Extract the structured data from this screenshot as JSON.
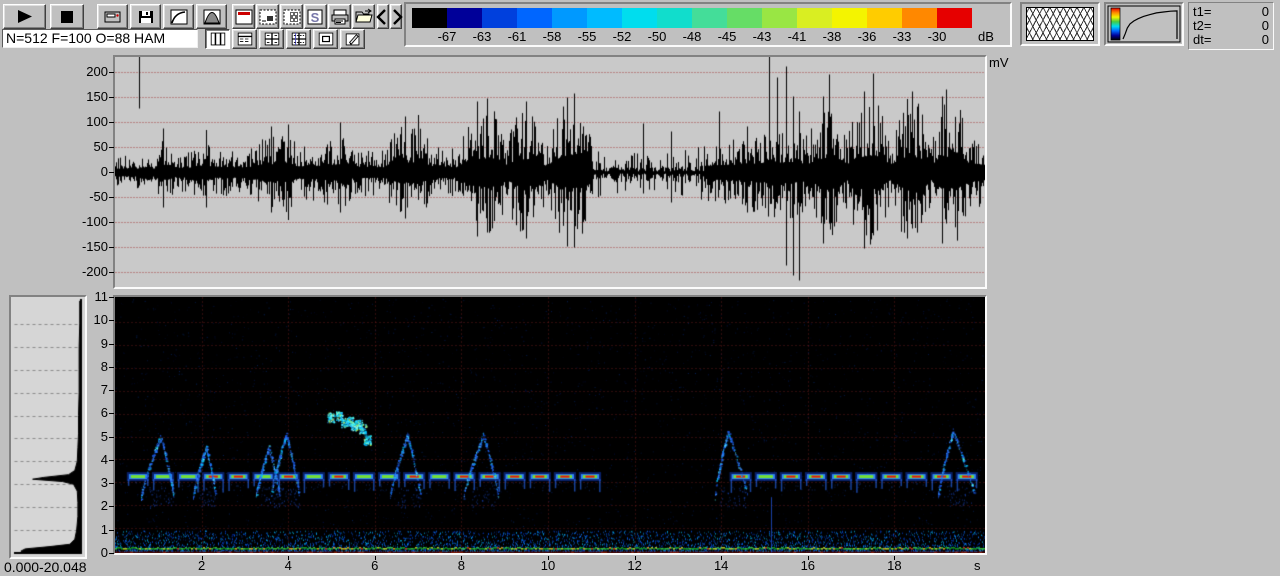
{
  "app": {
    "background": "#c0c0c0"
  },
  "toolbar": {
    "status_text": "N=512 F=100 O=88 HAM",
    "row1": [
      "play",
      "stop",
      "device",
      "save",
      "transfer",
      "window",
      "range",
      "fft",
      "pattern",
      "spectrum-s",
      "print",
      "open",
      "prev",
      "next"
    ],
    "row2": [
      "view-oscillogram",
      "view-sonagram",
      "view-split",
      "view-grid",
      "view-single",
      "edit"
    ]
  },
  "colorbar": {
    "unit": "dB",
    "ticks": [
      "-67",
      "-63",
      "-61",
      "-58",
      "-55",
      "-52",
      "-50",
      "-48",
      "-45",
      "-43",
      "-41",
      "-38",
      "-36",
      "-33",
      "-30"
    ],
    "colors": [
      "#000000",
      "#000099",
      "#0040dd",
      "#0066ff",
      "#0099ff",
      "#00bbff",
      "#00ddee",
      "#11ddcc",
      "#44dd99",
      "#66dd66",
      "#99e644",
      "#d9ee22",
      "#f4f400",
      "#ffcc00",
      "#ff8800",
      "#e60000"
    ]
  },
  "transfer_box": {
    "curve": [
      [
        0,
        0
      ],
      [
        0.04,
        0.18
      ],
      [
        0.08,
        0.38
      ],
      [
        0.13,
        0.52
      ],
      [
        0.2,
        0.62
      ],
      [
        0.28,
        0.7
      ],
      [
        0.38,
        0.78
      ],
      [
        0.5,
        0.84
      ],
      [
        0.62,
        0.9
      ],
      [
        0.75,
        0.93
      ],
      [
        0.88,
        0.96
      ],
      [
        1,
        0.97
      ]
    ],
    "bar_colors": [
      "#e60000",
      "#ff8800",
      "#f4f400",
      "#44cc44",
      "#00ddee",
      "#0066ff",
      "#000099",
      "#000000"
    ]
  },
  "time_readout": {
    "rows": [
      {
        "label": "t1=",
        "value": "0"
      },
      {
        "label": "t2=",
        "value": "0"
      },
      {
        "label": "dt=",
        "value": "0"
      }
    ]
  },
  "chart_data": [
    {
      "type": "line",
      "title": "oscillogram",
      "ylabel": "mV",
      "xlim_s": [
        0,
        20.048
      ],
      "ylim_mV": [
        -232,
        232
      ],
      "yticks_mV": [
        200,
        150,
        100,
        50,
        0,
        -50,
        -100,
        -150,
        -200
      ],
      "grid": "dotted-red-horizontal",
      "envelope_mV": [
        [
          0,
          34
        ],
        [
          0.9,
          36
        ],
        [
          1.0,
          60
        ],
        [
          1.2,
          68
        ],
        [
          1.35,
          42
        ],
        [
          1.9,
          46
        ],
        [
          2.05,
          66
        ],
        [
          2.3,
          48
        ],
        [
          3.1,
          46
        ],
        [
          3.4,
          72
        ],
        [
          3.95,
          80
        ],
        [
          4.25,
          52
        ],
        [
          4.8,
          62
        ],
        [
          5.2,
          76
        ],
        [
          5.55,
          50
        ],
        [
          6.2,
          48
        ],
        [
          6.55,
          92
        ],
        [
          7.05,
          90
        ],
        [
          7.35,
          52
        ],
        [
          7.9,
          48
        ],
        [
          8.2,
          120
        ],
        [
          8.75,
          128
        ],
        [
          9.05,
          62
        ],
        [
          9.25,
          118
        ],
        [
          9.65,
          122
        ],
        [
          9.95,
          60
        ],
        [
          10.25,
          132
        ],
        [
          10.75,
          140
        ],
        [
          11.0,
          62
        ],
        [
          11.4,
          42
        ],
        [
          12.5,
          40
        ],
        [
          13.4,
          52
        ],
        [
          13.9,
          66
        ],
        [
          14.5,
          72
        ],
        [
          15.0,
          88
        ],
        [
          15.6,
          92
        ],
        [
          16.0,
          78
        ],
        [
          16.25,
          118
        ],
        [
          16.6,
          138
        ],
        [
          16.9,
          72
        ],
        [
          17.15,
          138
        ],
        [
          17.6,
          148
        ],
        [
          17.9,
          68
        ],
        [
          18.15,
          128
        ],
        [
          18.55,
          138
        ],
        [
          18.85,
          68
        ],
        [
          19.05,
          138
        ],
        [
          19.45,
          142
        ],
        [
          19.7,
          88
        ],
        [
          20.05,
          70
        ]
      ],
      "sparse_region_s": [
        11,
        13.6
      ],
      "spikes_mV": [
        [
          0.55,
          232,
          128
        ],
        [
          1.1,
          88,
          -70
        ],
        [
          2.1,
          85,
          -70
        ],
        [
          3.6,
          92,
          -80
        ],
        [
          4.0,
          96,
          -95
        ],
        [
          5.2,
          100,
          -80
        ],
        [
          6.7,
          112,
          -92
        ],
        [
          7.0,
          115,
          -50
        ],
        [
          8.35,
          142,
          -128
        ],
        [
          8.6,
          148,
          -120
        ],
        [
          9.5,
          142,
          -132
        ],
        [
          10.45,
          150,
          -148
        ],
        [
          10.6,
          158,
          -150
        ],
        [
          12.2,
          98,
          -42
        ],
        [
          12.85,
          82,
          -60
        ],
        [
          13.95,
          122,
          -35
        ],
        [
          14.6,
          92,
          -80
        ],
        [
          15.1,
          248,
          -32
        ],
        [
          15.3,
          190,
          -62
        ],
        [
          15.5,
          212,
          -186
        ],
        [
          15.65,
          152,
          -206
        ],
        [
          15.8,
          122,
          -216
        ],
        [
          16.35,
          152,
          -142
        ],
        [
          16.5,
          196,
          -102
        ],
        [
          17.3,
          162,
          -152
        ],
        [
          17.5,
          198,
          -122
        ],
        [
          18.3,
          147,
          -132
        ],
        [
          18.4,
          162,
          -112
        ],
        [
          19.1,
          152,
          -142
        ],
        [
          19.2,
          166,
          -102
        ]
      ]
    },
    {
      "type": "heatmap",
      "title": "spectrogram",
      "xlabel_unit": "s",
      "xlim_s": [
        0,
        20.048
      ],
      "ylim_kHz": [
        0,
        11
      ],
      "yticks_kHz": [
        0,
        1,
        2,
        3,
        4,
        5,
        6,
        7,
        8,
        9,
        10,
        11
      ],
      "xticks_s": [
        2,
        4,
        6,
        8,
        10,
        12,
        14,
        16,
        18
      ],
      "grid": "dotted-darkred 1kHz / 2s",
      "band_kHz": 3.27,
      "band_dashes": {
        "t_start": 0.32,
        "t_end": 19.5,
        "pitch": 0.58,
        "len": 0.42,
        "gaps": [
          [
            10.95,
            13.92
          ]
        ]
      },
      "calls": [
        {
          "t": 1.05,
          "peak": 5.0,
          "wl": 0.45,
          "wr": 0.3
        },
        {
          "t": 2.1,
          "peak": 4.55,
          "wl": 0.3,
          "wr": 0.22
        },
        {
          "t": 3.55,
          "peak": 4.5,
          "wl": 0.3,
          "wr": 0.25
        },
        {
          "t": 3.95,
          "peak": 5.1,
          "wl": 0.35,
          "wr": 0.3
        },
        {
          "t": 6.75,
          "peak": 5.05,
          "wl": 0.4,
          "wr": 0.3
        },
        {
          "t": 8.5,
          "peak": 5.05,
          "wl": 0.45,
          "wr": 0.35
        },
        {
          "t": 14.15,
          "peak": 5.2,
          "wl": 0.3,
          "wr": 0.45
        },
        {
          "t": 19.35,
          "peak": 5.25,
          "wl": 0.35,
          "wr": 0.5
        }
      ],
      "cluster_blobs_t_kHz": [
        [
          4.98,
          5.85
        ],
        [
          5.18,
          5.9
        ],
        [
          5.3,
          5.62
        ],
        [
          5.42,
          5.68
        ],
        [
          5.52,
          5.48
        ],
        [
          5.62,
          5.52
        ],
        [
          5.72,
          5.35
        ],
        [
          5.82,
          4.85
        ]
      ],
      "vertical_streak": {
        "t": 15.15,
        "f0": 0,
        "f1": 2.4
      }
    },
    {
      "type": "line",
      "title": "average-spectrum",
      "range_label": "0.000-20.048",
      "orientation": "vertical",
      "ylim_kHz": [
        0,
        11
      ],
      "profile_kHz_rel": [
        [
          0,
          0.9
        ],
        [
          0.08,
          0.97
        ],
        [
          0.18,
          0.9
        ],
        [
          0.28,
          0.5
        ],
        [
          0.38,
          0.18
        ],
        [
          0.6,
          0.1
        ],
        [
          1,
          0.07
        ],
        [
          1.6,
          0.05
        ],
        [
          2.2,
          0.05
        ],
        [
          2.7,
          0.06
        ],
        [
          3.0,
          0.12
        ],
        [
          3.12,
          0.3
        ],
        [
          3.22,
          0.78
        ],
        [
          3.3,
          0.6
        ],
        [
          3.42,
          0.2
        ],
        [
          3.6,
          0.1
        ],
        [
          4,
          0.06
        ],
        [
          4.6,
          0.05
        ],
        [
          5.2,
          0.04
        ],
        [
          6,
          0.04
        ],
        [
          7,
          0.03
        ],
        [
          8,
          0.03
        ],
        [
          9,
          0.03
        ],
        [
          10,
          0.02
        ],
        [
          11,
          0.02
        ]
      ]
    }
  ],
  "oscillogram_panel": {
    "unit": "mV"
  },
  "spectrogram_panel": {
    "unit": "s"
  },
  "spectrum_panel": {
    "range_label": "0.000-20.048"
  }
}
